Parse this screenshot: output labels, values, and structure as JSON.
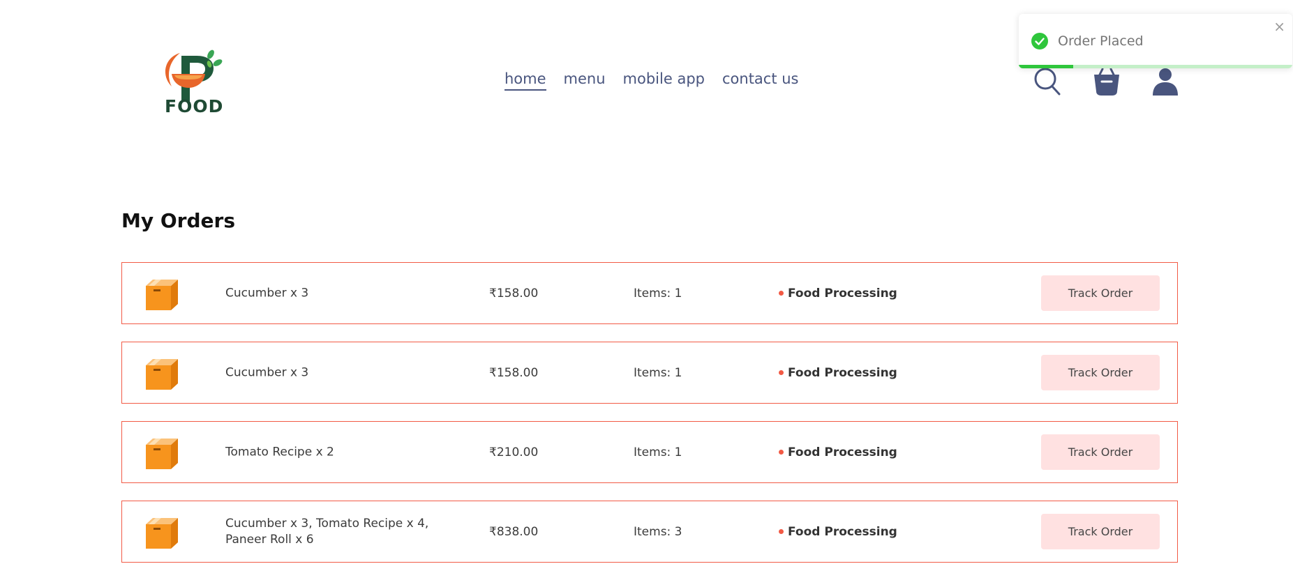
{
  "brand": {
    "logo_text": "FOOD",
    "logo_icon": "mortar-bowl-leaf-logo"
  },
  "nav": {
    "items": [
      {
        "label": "home",
        "active": true
      },
      {
        "label": "menu",
        "active": false
      },
      {
        "label": "mobile app",
        "active": false
      },
      {
        "label": "contact us",
        "active": false
      }
    ],
    "icons": [
      "search-icon",
      "basket-icon",
      "profile-icon"
    ]
  },
  "toast": {
    "message": "Order Placed",
    "close_glyph": "×",
    "icon": "check-circle-icon",
    "progress_fraction": 0.2
  },
  "orders_section": {
    "title": "My Orders",
    "track_label": "Track Order",
    "orders": [
      {
        "items": "Cucumber x 3",
        "amount": "₹158.00",
        "count": "Items: 1",
        "status": "Food Processing"
      },
      {
        "items": "Cucumber x 3",
        "amount": "₹158.00",
        "count": "Items: 1",
        "status": "Food Processing"
      },
      {
        "items": "Tomato Recipe x 2",
        "amount": "₹210.00",
        "count": "Items: 1",
        "status": "Food Processing"
      },
      {
        "items": "Cucumber x 3, Tomato Recipe x 4, Paneer Roll x 6",
        "amount": "₹838.00",
        "count": "Items: 3",
        "status": "Food Processing"
      }
    ]
  },
  "colors": {
    "accent": "#f25a45",
    "nav_text": "#49557e",
    "track_button_bg": "#ffe1e1",
    "toast_success": "#2fc63c",
    "parcel": "#f7941d"
  }
}
